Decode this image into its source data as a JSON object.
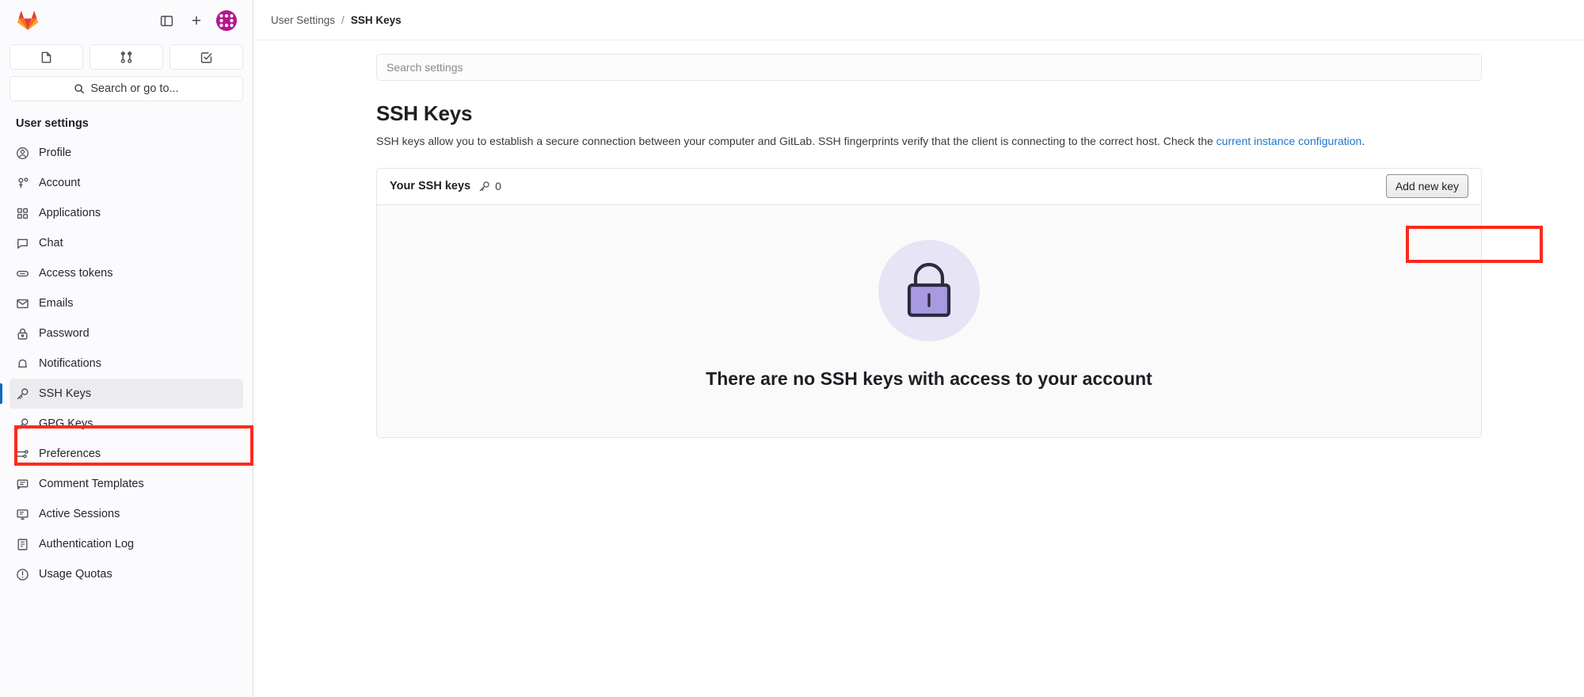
{
  "sidebar": {
    "logo_name": "gitlab-logo",
    "top_actions": [
      {
        "name": "toggle-sidebar-icon",
        "label": "Toggle sidebar"
      },
      {
        "name": "create-new-icon",
        "label": "+"
      }
    ],
    "avatar_label": "User avatar",
    "shortcuts": [
      {
        "name": "issues-icon",
        "label": "Issues"
      },
      {
        "name": "merge-requests-icon",
        "label": "Merge requests"
      },
      {
        "name": "todo-list-icon",
        "label": "To-Do List"
      }
    ],
    "search_placeholder": "Search or go to...",
    "section_title": "User settings",
    "items": [
      {
        "label": "Profile",
        "icon": "profile-icon",
        "active": false
      },
      {
        "label": "Account",
        "icon": "account-icon",
        "active": false
      },
      {
        "label": "Applications",
        "icon": "applications-icon",
        "active": false
      },
      {
        "label": "Chat",
        "icon": "chat-icon",
        "active": false
      },
      {
        "label": "Access tokens",
        "icon": "token-icon",
        "active": false
      },
      {
        "label": "Emails",
        "icon": "email-icon",
        "active": false
      },
      {
        "label": "Password",
        "icon": "password-lock-icon",
        "active": false
      },
      {
        "label": "Notifications",
        "icon": "notification-bell-icon",
        "active": false
      },
      {
        "label": "SSH Keys",
        "icon": "key-icon",
        "active": true
      },
      {
        "label": "GPG Keys",
        "icon": "key-icon",
        "active": false
      },
      {
        "label": "Preferences",
        "icon": "preferences-sliders-icon",
        "active": false
      },
      {
        "label": "Comment Templates",
        "icon": "comment-icon",
        "active": false
      },
      {
        "label": "Active Sessions",
        "icon": "monitor-icon",
        "active": false
      },
      {
        "label": "Authentication Log",
        "icon": "log-book-icon",
        "active": false
      },
      {
        "label": "Usage Quotas",
        "icon": "quota-clock-icon",
        "active": false
      }
    ]
  },
  "breadcrumb": {
    "parent": "User Settings",
    "separator": "/",
    "current": "SSH Keys"
  },
  "settings_search": {
    "placeholder": "Search settings",
    "value": ""
  },
  "page": {
    "title": "SSH Keys",
    "description_part1": "SSH keys allow you to establish a secure connection between your computer and GitLab. SSH fingerprints verify that the client is connecting to the correct host. Check the ",
    "description_link": "current instance configuration",
    "description_part2": "."
  },
  "keys_card": {
    "title": "Your SSH keys",
    "key_icon": "key-icon",
    "count": "0",
    "add_button": "Add new key",
    "empty_state": {
      "illustration": "lock-illustration",
      "title": "There are no SSH keys with access to your account"
    }
  },
  "annotations": [
    {
      "name": "annotation-ssh-keys-nav",
      "color": "#fc2a1c"
    },
    {
      "name": "annotation-add-new-key",
      "color": "#fc2a1c"
    }
  ],
  "colors": {
    "accent_blue": "#1f75cb",
    "active_indicator": "#1068bf",
    "annotation_red": "#fc2a1c",
    "lock_purple": "#a89ae0",
    "lock_circle": "#e7e4f5",
    "sidebar_bg": "#fbfafd"
  }
}
